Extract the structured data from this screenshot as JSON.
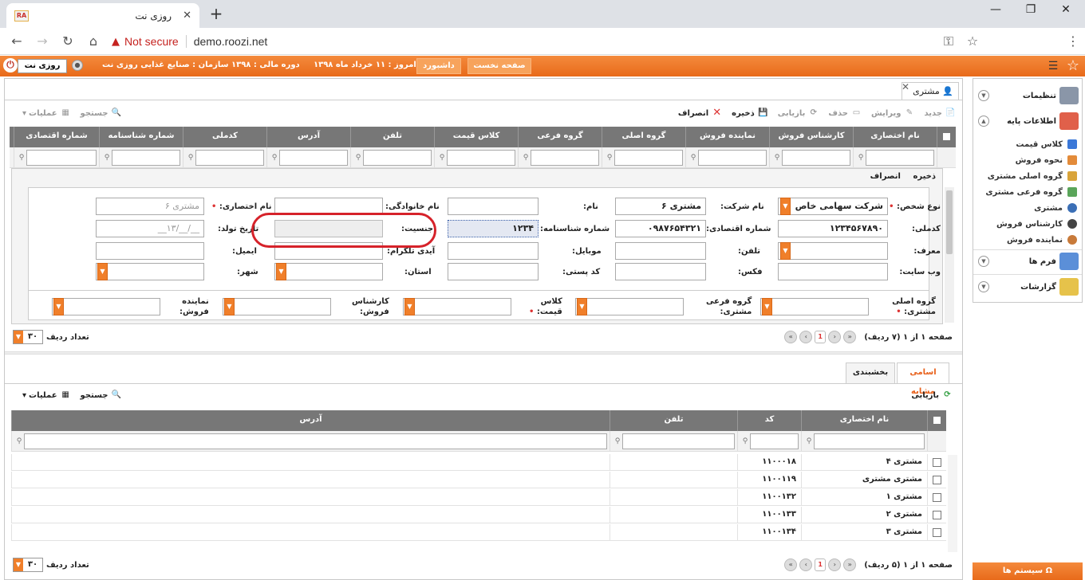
{
  "browser": {
    "tab_title": "روزی نت",
    "favicon_text": "RA",
    "not_secure": "Not secure",
    "url": "demo.roozi.net"
  },
  "header": {
    "brand_button": "روزی نت",
    "org_label": "سازمان : صنایع غذایی روزی نت",
    "period_label": "دوره مالی : ۱۳۹۸",
    "today_label": "امروز : ۱۱ خرداد ماه ۱۳۹۸",
    "dashboard": "داشبورد",
    "home": "صفحه نخست"
  },
  "content": {
    "tab_label": "مشتری",
    "toolbar": {
      "new": "جدید",
      "edit": "ویرایش",
      "delete": "حذف",
      "refresh": "بازیابی",
      "save": "ذخیره",
      "cancel": "انصراف",
      "search": "جستجو",
      "operations": "عملیات"
    },
    "grid": {
      "columns": [
        "نام اختصاری",
        "کارشناس فروش",
        "نماینده فروش",
        "گروه اصلی",
        "گروه فرعی",
        "کلاس قیمت",
        "تلفن",
        "آدرس",
        "کدملی",
        "شماره شناسنامه",
        "شماره اقتصادی"
      ]
    },
    "form": {
      "save": "ذخیره",
      "cancel": "انصراف",
      "person_type_label": "نوع شخص:",
      "person_type_value": "شرکت سهامی خاص",
      "company_name_label": "نام شرکت:",
      "company_name_value": "مشتری ۶",
      "name_label": "نام:",
      "family_label": "نام خانوادگی:",
      "short_name_label": "نام اختصاری:",
      "short_name_value": "مشتری ۶",
      "national_code_label": "کدملی:",
      "national_code_value": "۱۲۳۴۵۶۷۸۹۰",
      "economic_no_label": "شماره اقتصادی:",
      "economic_no_value": "۰۹۸۷۶۵۴۳۲۱",
      "id_no_label": "شماره شناسنامه:",
      "id_no_value": "۱۲۳۴",
      "gender_label": "جنسیت:",
      "birth_date_label": "تاریخ تولد:",
      "birth_date_value": "__/__/۱۳__",
      "introducer_label": "معرف:",
      "phone_label": "تلفن:",
      "mobile_label": "موبایل:",
      "telegram_label": "آیدی تلگرام:",
      "email_label": "ایمیل:",
      "website_label": "وب سایت:",
      "fax_label": "فکس:",
      "postal_label": "کد پستی:",
      "province_label": "استان:",
      "city_label": "شهر:",
      "main_group_label_1": "گروه اصلی",
      "main_group_label_2": "مشتری:",
      "sub_group_label_1": "گروه فرعی",
      "sub_group_label_2": "مشتری:",
      "price_class_label_1": "کلاس",
      "price_class_label_2": "قیمت:",
      "expert_label_1": "کارشناس",
      "expert_label_2": "فروش:",
      "agent_label_1": "نماینده",
      "agent_label_2": "فروش:"
    },
    "pager_top": {
      "text": "صفحه ۱ از ۱ (۷ ردیف)",
      "page": "1"
    },
    "rows_top": {
      "label": "تعداد ردیف",
      "value": "۳۰"
    },
    "bottom_tabs": {
      "similar": "اسامی مشابه",
      "segmentation": "بخشبندی"
    },
    "bottom_toolbar": {
      "refresh": "بازیابی",
      "search": "جستجو",
      "operations": "عملیات"
    },
    "bottom_grid": {
      "columns": [
        "نام اختصاری",
        "کد",
        "تلفن",
        "آدرس"
      ],
      "rows": [
        {
          "name": "مشتری ۴",
          "code": "۱۱۰۰۰۱۸"
        },
        {
          "name": "مشتری مشتری",
          "code": "۱۱۰۰۱۱۹"
        },
        {
          "name": "مشتری ۱",
          "code": "۱۱۰۰۱۳۲"
        },
        {
          "name": "مشتری ۲",
          "code": "۱۱۰۰۱۳۳"
        },
        {
          "name": "مشتری ۳",
          "code": "۱۱۰۰۱۳۴"
        }
      ]
    },
    "pager_bottom": {
      "text": "صفحه ۱ از ۱ (۵ ردیف)",
      "page": "1"
    },
    "rows_bottom": {
      "label": "تعداد ردیف",
      "value": "۳۰"
    }
  },
  "sidebar": {
    "settings": "تنظیمات",
    "base_info": "اطلاعات پایه",
    "items": [
      "کلاس قیمت",
      "نحوه فروش",
      "گروه اصلی مشتری",
      "گروه فرعی مشتری",
      "مشتری",
      "کارشناس فروش",
      "نماینده فروش"
    ],
    "forms": "فرم ها",
    "reports": "گزارشات",
    "system": "سیستم ها"
  },
  "colors": {
    "accent": "#e86a1a",
    "highlight": "#d6222a",
    "grid_header": "#777777"
  }
}
